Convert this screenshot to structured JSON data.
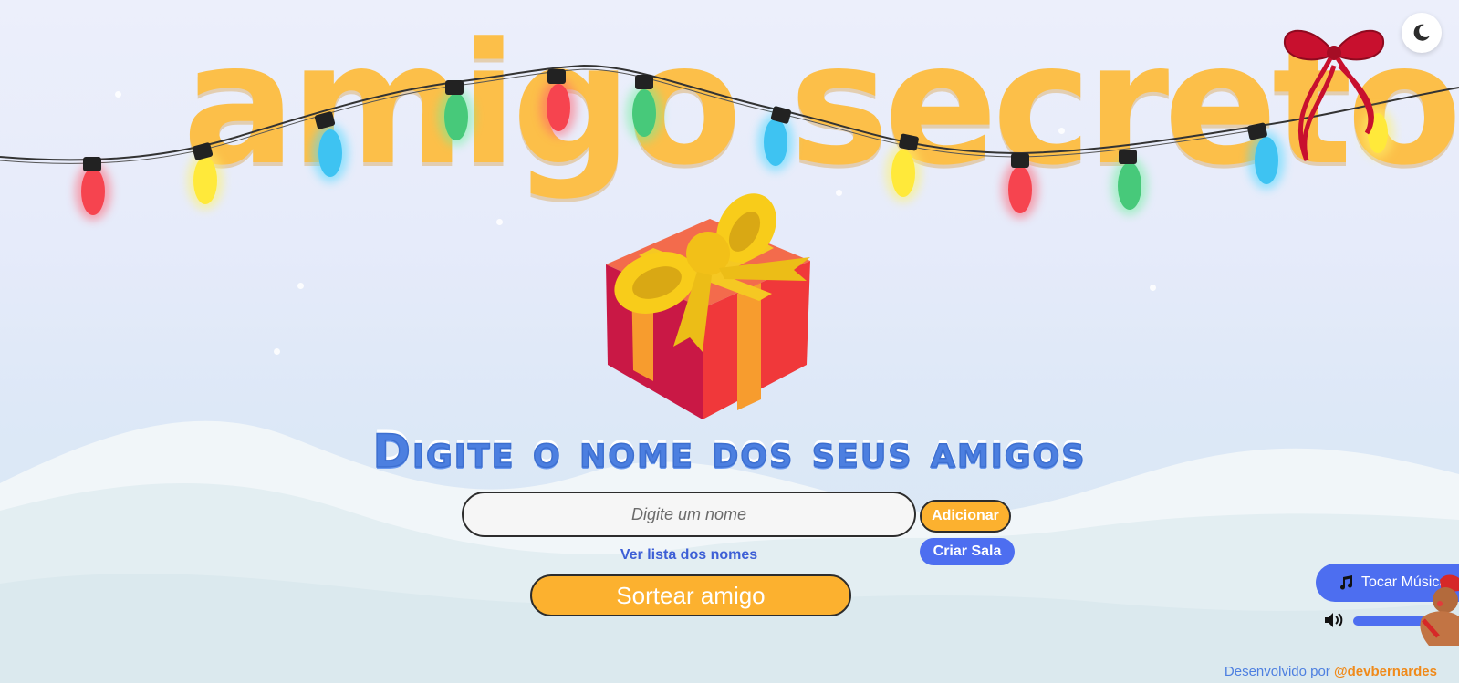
{
  "header": {
    "title": "amigo secreto",
    "theme_toggle_icon": "moon-icon"
  },
  "main": {
    "subtitle": "Digite o nome dos seus amigos",
    "input": {
      "placeholder": "Digite um nome",
      "value": ""
    },
    "add_button": "Adicionar",
    "create_room_button": "Criar Sala",
    "view_list_link": "Ver lista dos nomes",
    "draw_button": "Sortear amigo"
  },
  "music": {
    "play_button": "Tocar Música",
    "play_icon": "music-note-icon",
    "volume_icon": "volume-icon",
    "volume_level": 0.9
  },
  "footer": {
    "prefix": "Desenvolvido por",
    "handle": "@devbernardes"
  },
  "colors": {
    "title": "#fcbf49",
    "accent_blue": "#4d6ef0",
    "accent_orange": "#fcb12f",
    "subtitle_blue": "#4c7fe0"
  }
}
